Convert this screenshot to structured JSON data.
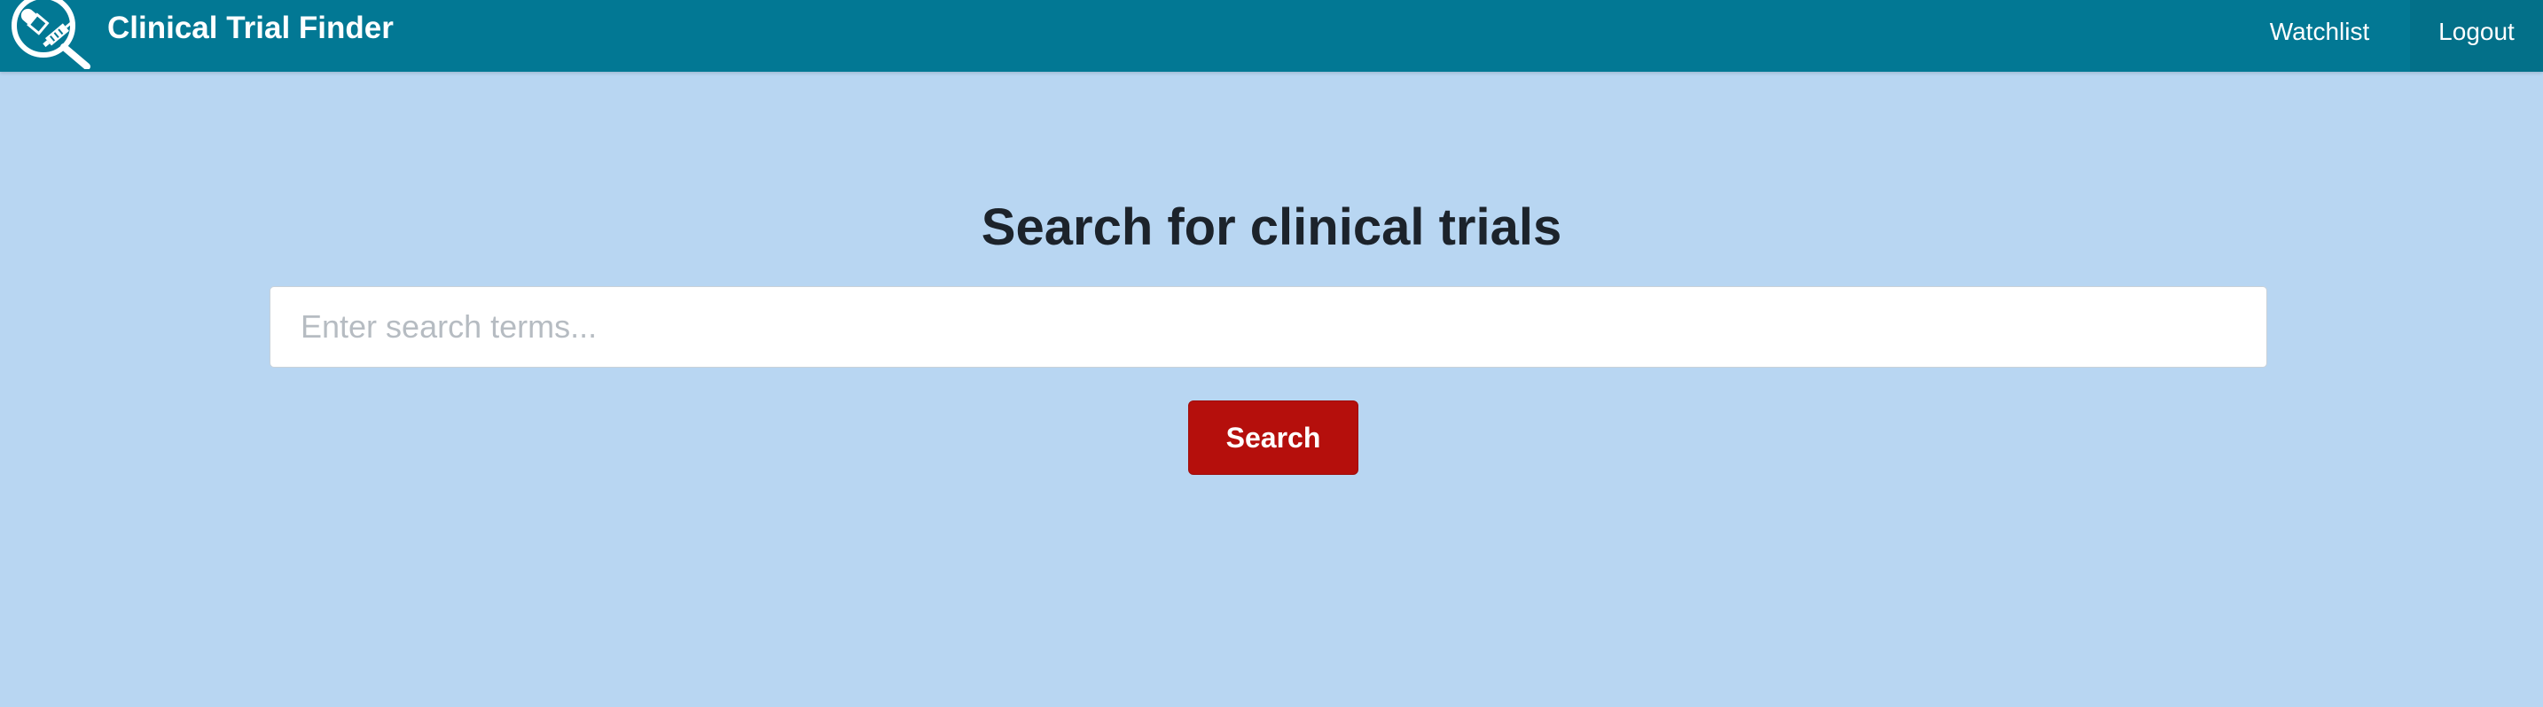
{
  "app": {
    "title": "Clinical Trial Finder",
    "logo_icon": "pill-syringe-magnifier-icon"
  },
  "nav": {
    "items": [
      {
        "label": "Watchlist"
      },
      {
        "label": "Logout"
      }
    ]
  },
  "main": {
    "heading": "Search for clinical trials",
    "search": {
      "placeholder": "Enter search terms...",
      "value": ""
    },
    "search_button_label": "Search"
  },
  "colors": {
    "navbar": "#027894",
    "page_background": "#b8d6f2",
    "search_button": "#b50f0c",
    "heading_text": "#1c232b"
  }
}
